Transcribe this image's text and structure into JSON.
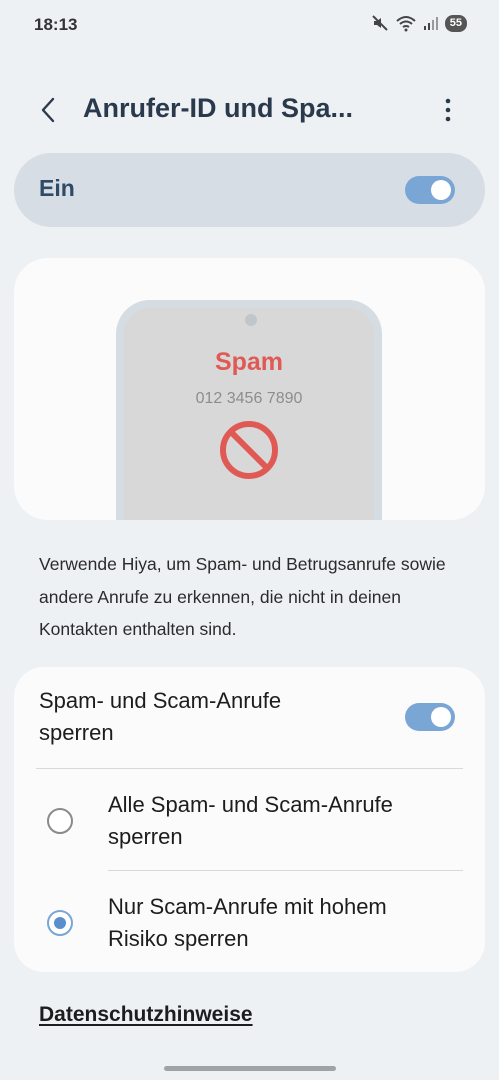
{
  "status_bar": {
    "time": "18:13",
    "battery": "55",
    "icons": [
      "mute-icon",
      "wifi-icon",
      "signal-icon",
      "battery-icon"
    ]
  },
  "header": {
    "title": "Anrufer-ID und Spa...",
    "back_icon": "chevron-left-icon",
    "more_icon": "more-vertical-icon"
  },
  "master_switch": {
    "label": "Ein",
    "enabled": true
  },
  "illustration": {
    "spam_label": "Spam",
    "phone_number": "012 3456 7890",
    "icon": "block-icon"
  },
  "description": "Verwende Hiya, um Spam- und Betrugsanrufe sowie andere Anrufe zu erkennen, die nicht in deinen Kontakten enthalten sind.",
  "settings": {
    "block_spam_label": "Spam- und Scam-Anrufe sperren",
    "block_spam_enabled": true,
    "options": [
      {
        "label": "Alle Spam- und Scam-Anrufe sperren",
        "selected": false
      },
      {
        "label": "Nur Scam-Anrufe mit hohem Risiko sperren",
        "selected": true
      }
    ]
  },
  "privacy_link": "Datenschutzhinweise",
  "colors": {
    "background": "#eef1f4",
    "accent": "#7aa6d6",
    "spam_red": "#e05a55",
    "title": "#2a3a4c"
  }
}
